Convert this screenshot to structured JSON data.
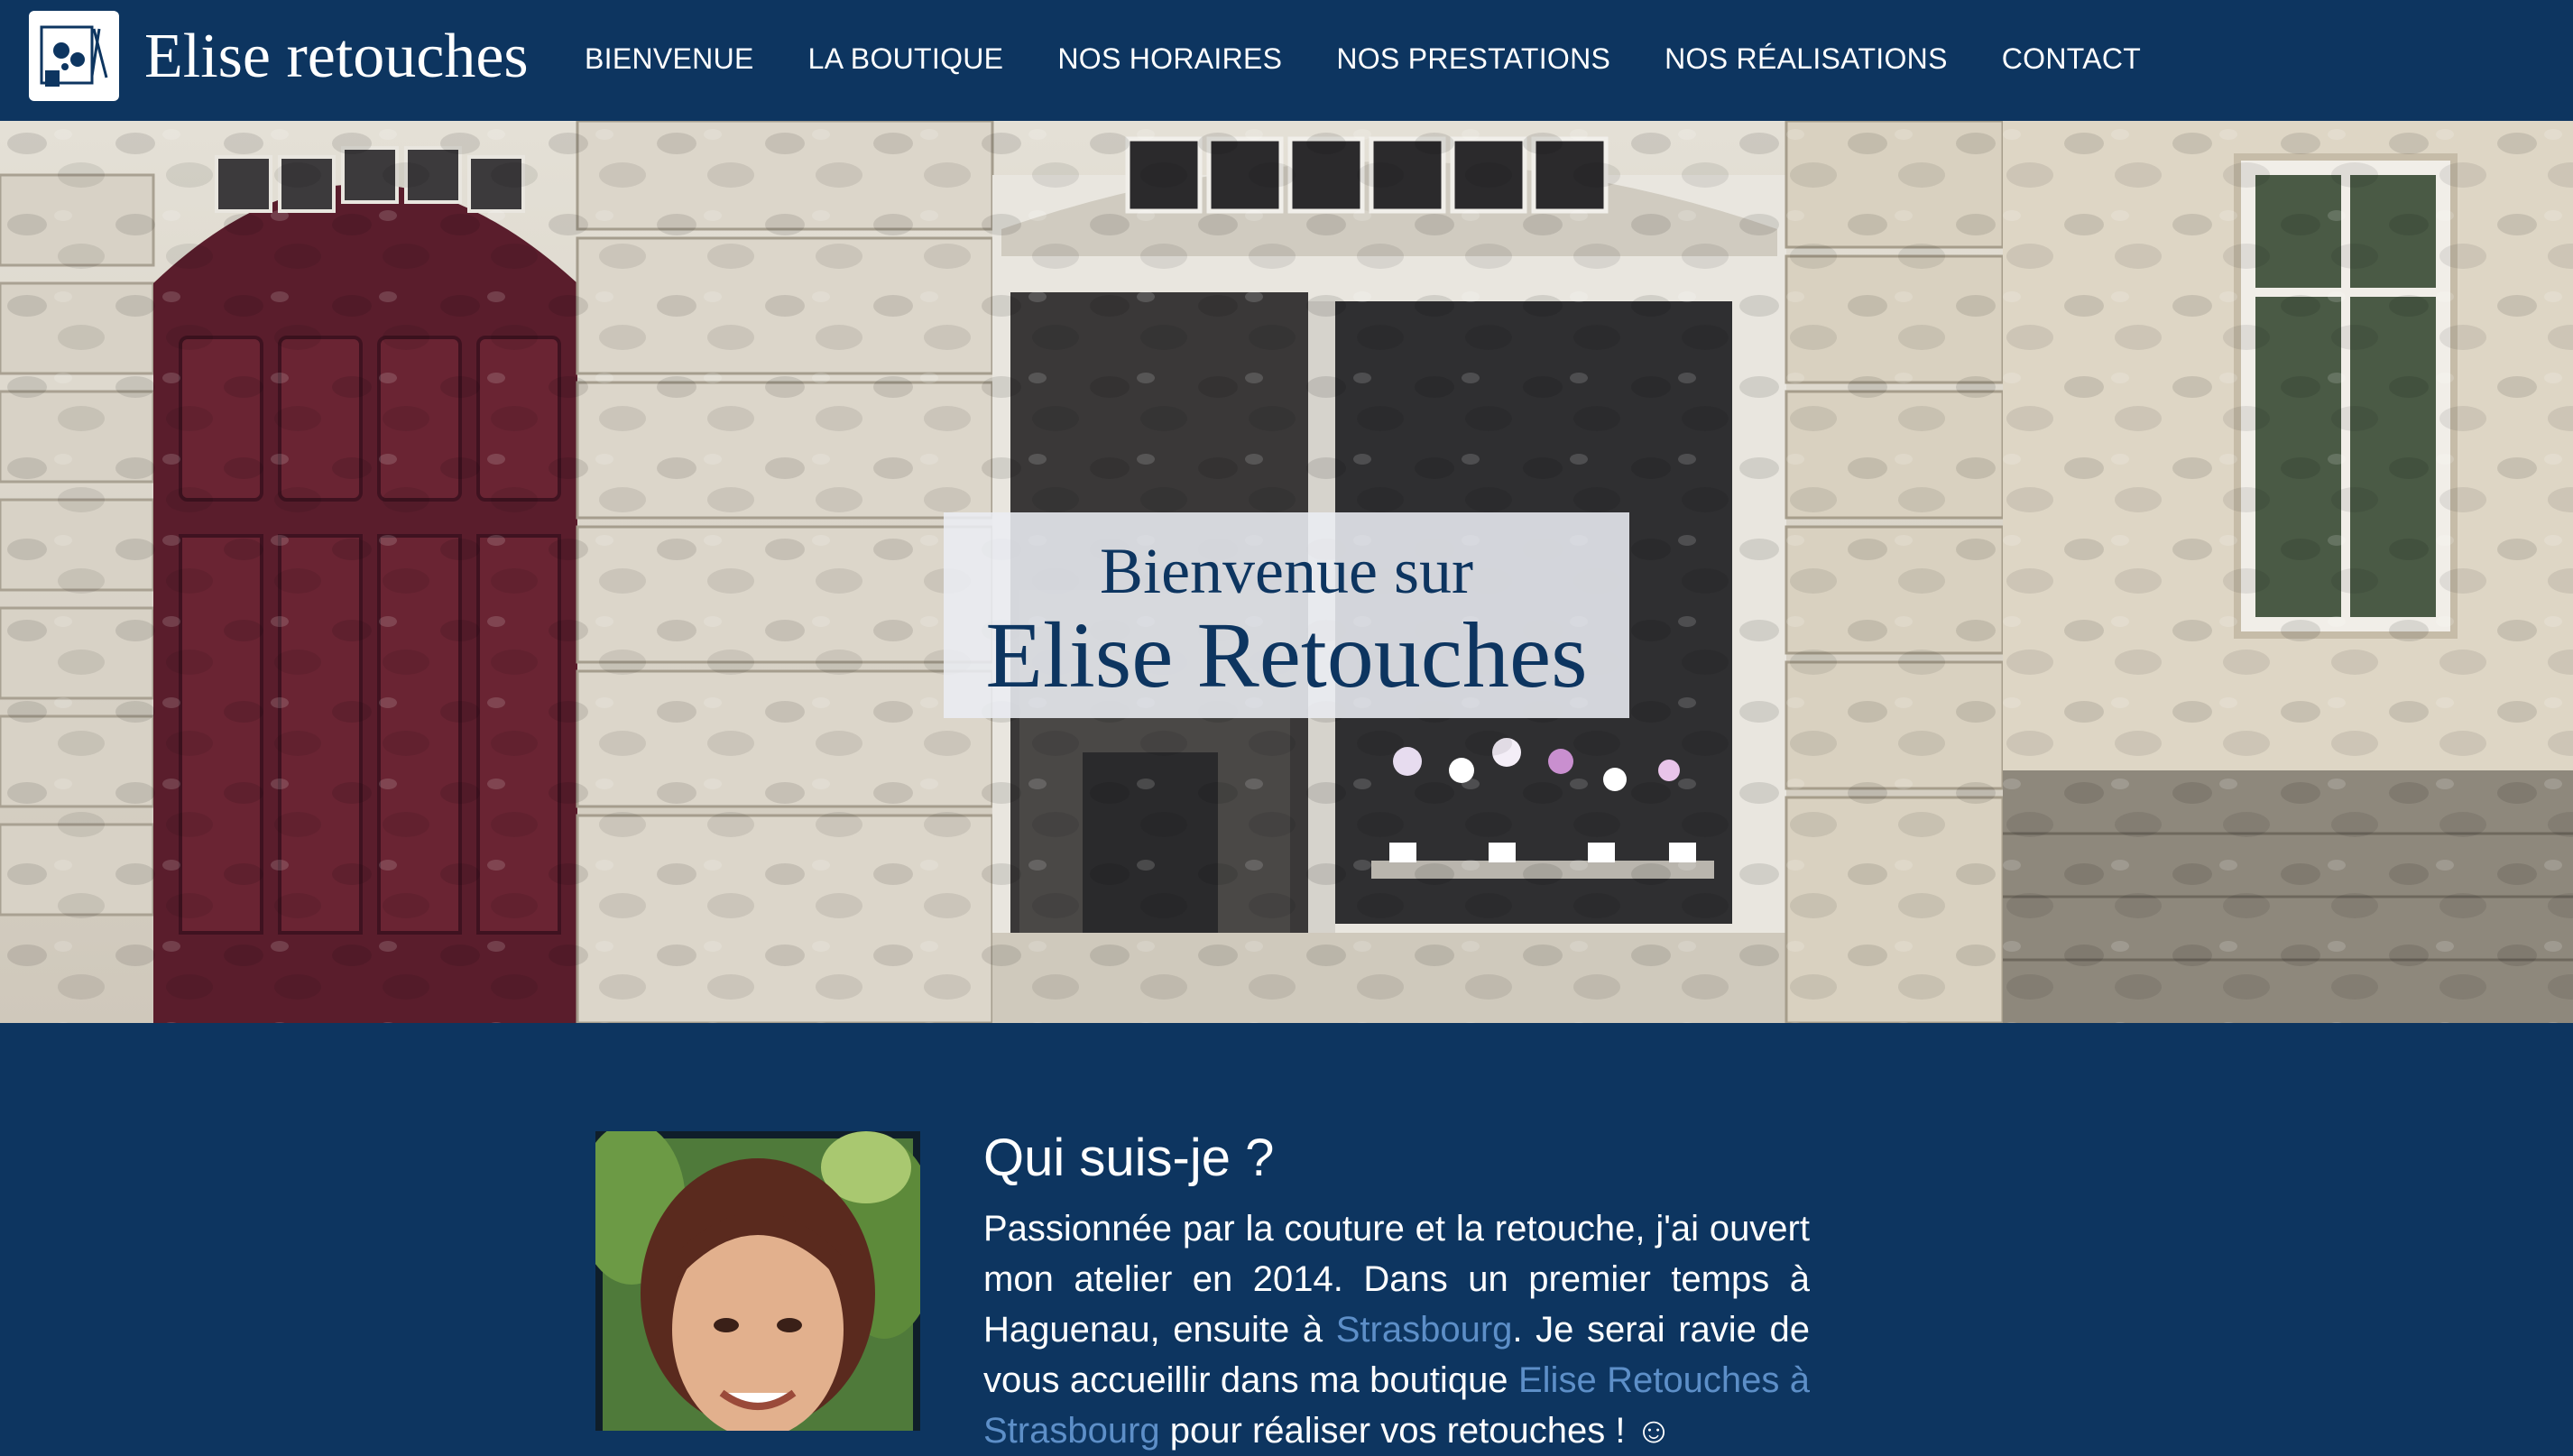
{
  "header": {
    "site_title": "Elise retouches",
    "logo_icon": "sewing-logo-icon",
    "nav": [
      {
        "label": "BIENVENUE"
      },
      {
        "label": "LA BOUTIQUE"
      },
      {
        "label": "NOS HORAIRES"
      },
      {
        "label": "NOS PRESTATIONS"
      },
      {
        "label": "NOS RÉALISATIONS"
      },
      {
        "label": "CONTACT"
      }
    ]
  },
  "hero": {
    "line1": "Bienvenue sur",
    "line2": "Elise Retouches"
  },
  "about": {
    "title": "Qui suis-je ?",
    "text_1": "Passionnée par la couture et la retouche, j'ai ouvert mon atelier en 2014. Dans un premier temps à Haguenau, ensuite à ",
    "link_1": "Strasbourg",
    "text_2": ". Je serai ravie de vous accueillir dans ma boutique ",
    "link_2": "Elise Retouches à Strasbourg",
    "text_3": " pour réaliser vos retouches ! ☺"
  },
  "colors": {
    "brand_navy": "#0d3560",
    "link_blue": "#5d8fc8",
    "white": "#ffffff"
  }
}
